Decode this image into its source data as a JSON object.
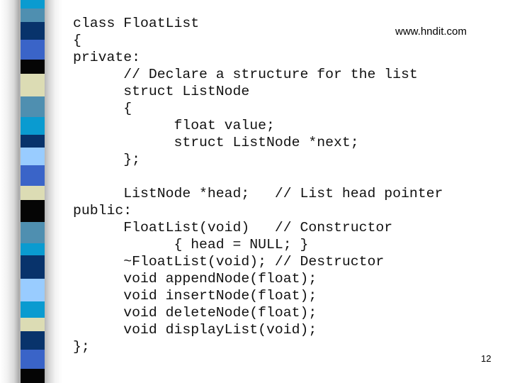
{
  "slide": {
    "website": "www.hndit.com",
    "page_number": "12",
    "code_lines": [
      "class FloatList",
      "{",
      "private:",
      "      // Declare a structure for the list",
      "      struct ListNode",
      "      {",
      "            float value;",
      "            struct ListNode *next;",
      "      };",
      "",
      "      ListNode *head;   // List head pointer",
      "public:",
      "      FloatList(void)   // Constructor",
      "            { head = NULL; }",
      "      ~FloatList(void); // Destructor",
      "      void appendNode(float);",
      "      void insertNode(float);",
      "      void deleteNode(float);",
      "      void displayList(void);",
      "};"
    ]
  },
  "decoration": {
    "stripe_colors": [
      "#0a9bd0",
      "#4f8fb0",
      "#08336b",
      "#3a64c8",
      "#050505",
      "#dcdcb4",
      "#4f8fb0",
      "#0a9bd0",
      "#08336b",
      "#99ccff",
      "#3a64c8",
      "#dcdcb4",
      "#050505",
      "#4f8fb0",
      "#0a9bd0",
      "#08336b",
      "#99ccff",
      "#0a9bd0",
      "#dcdcb4",
      "#08336b",
      "#3a64c8",
      "#050505"
    ]
  }
}
